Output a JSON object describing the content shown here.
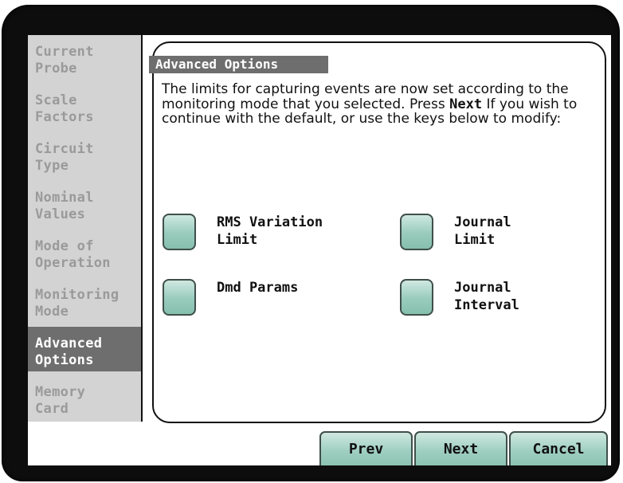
{
  "sidebar": {
    "items": [
      {
        "line1": "Current",
        "line2": "Probe",
        "active": false
      },
      {
        "line1": "Scale",
        "line2": "Factors",
        "active": false
      },
      {
        "line1": "Circuit",
        "line2": "Type",
        "active": false
      },
      {
        "line1": "Nominal",
        "line2": "Values",
        "active": false
      },
      {
        "line1": "Mode of",
        "line2": "Operation",
        "active": false
      },
      {
        "line1": "Monitoring",
        "line2": "Mode",
        "active": false
      },
      {
        "line1": "Advanced",
        "line2": "Options",
        "active": true
      },
      {
        "line1": "Memory",
        "line2": "Card",
        "active": false
      }
    ]
  },
  "panel": {
    "title": "Advanced Options",
    "intro_before": "The limits for capturing events are now set according to the monitoring mode that you selected. Press ",
    "intro_bold": "Next",
    "intro_after": " If you wish to continue with the default, or use the keys below to modify:",
    "options": {
      "rms_variation": "RMS Variation\nLimit",
      "journal_limit": "Journal\nLimit",
      "dmd_params": "Dmd Params",
      "journal_interval": "Journal\nInterval"
    }
  },
  "nav": {
    "prev": "Prev",
    "next": "Next",
    "cancel": "Cancel"
  },
  "colors": {
    "sidebar_bg": "#d3d3d3",
    "sidebar_active_bg": "#6e6e6e",
    "sidebar_text": "#9a9a9a",
    "button_teal": "#98cbbd",
    "bezel": "#0d0d0d"
  }
}
